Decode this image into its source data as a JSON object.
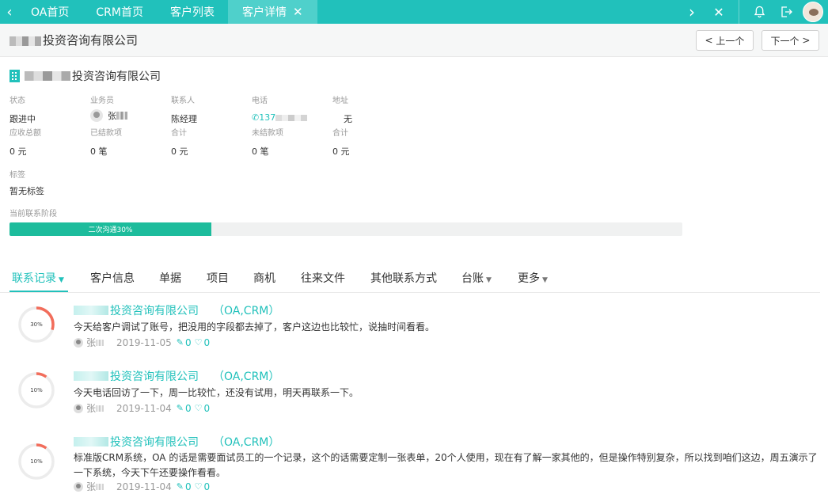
{
  "topbar": {
    "tabs": [
      {
        "label": "OA首页"
      },
      {
        "label": "CRM首页"
      },
      {
        "label": "客户列表"
      },
      {
        "label": "客户详情",
        "active": true
      }
    ]
  },
  "header": {
    "title": "投资咨询有限公司",
    "prev_label": "上一个",
    "next_label": "下一个"
  },
  "company": {
    "name": "投资咨询有限公司"
  },
  "info": {
    "row1": [
      {
        "label": "状态",
        "value": "跟进中"
      },
      {
        "label": "业务员",
        "value": "张"
      },
      {
        "label": "联系人",
        "value": "陈经理"
      },
      {
        "label": "电话",
        "value": "137"
      },
      {
        "label": "地址",
        "value": "无"
      }
    ],
    "row2": [
      {
        "label": "应收总额",
        "value": "0 元"
      },
      {
        "label": "已结款项",
        "value": "0 笔"
      },
      {
        "label": "合计",
        "value": "0 元"
      },
      {
        "label": "未结款项",
        "value": "0 笔"
      },
      {
        "label": "合计",
        "value": "0 元"
      }
    ]
  },
  "tags": {
    "label": "标签",
    "value": "暂无标签"
  },
  "stage": {
    "label": "当前联系阶段",
    "text": "二次沟通30%",
    "progress": 0.3
  },
  "content_tabs": [
    {
      "label": "联系记录",
      "active": true,
      "dropdown": true
    },
    {
      "label": "客户信息"
    },
    {
      "label": "单据"
    },
    {
      "label": "项目"
    },
    {
      "label": "商机"
    },
    {
      "label": "往来文件"
    },
    {
      "label": "其他联系方式"
    },
    {
      "label": "台账",
      "dropdown": true
    },
    {
      "label": "更多",
      "dropdown": true
    }
  ],
  "records": [
    {
      "pct_label": "30%",
      "progress": 0.3,
      "company": "投资咨询有限公司",
      "tag": "（OA,CRM）",
      "text": "今天给客户调试了账号，把没用的字段都去掉了，客户这边也比较忙，说抽时间看看。",
      "user": "张",
      "date": "2019-11-05",
      "edits": "0",
      "likes": "0"
    },
    {
      "pct_label": "10%",
      "progress": 0.1,
      "company": "投资咨询有限公司",
      "tag": "（OA,CRM）",
      "text": "今天电话回访了一下，周一比较忙，还没有试用，明天再联系一下。",
      "user": "张",
      "date": "2019-11-04",
      "edits": "0",
      "likes": "0"
    },
    {
      "pct_label": "10%",
      "progress": 0.1,
      "company": "投资咨询有限公司",
      "tag": "（OA,CRM）",
      "text": "标准版CRM系统，OA 的话是需要面试员工的一个记录，这个的话需要定制一张表单，20个人使用，现在有了解一家其他的，但是操作特别复杂，所以找到咱们这边，周五演示了一下系统，今天下午还要操作看看。",
      "user": "张",
      "date": "2019-11-04",
      "edits": "0",
      "likes": "0"
    }
  ]
}
